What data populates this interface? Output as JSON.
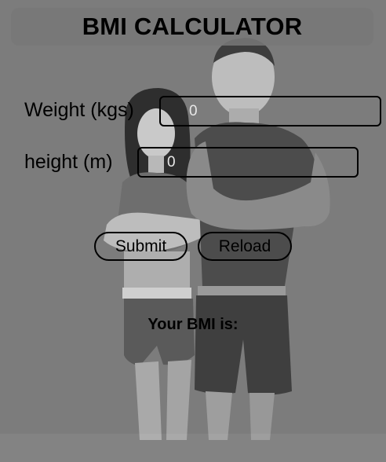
{
  "app": {
    "title": "BMI CALCULATOR"
  },
  "form": {
    "weight": {
      "label": "Weight (kgs)",
      "value": "0"
    },
    "height": {
      "label": "height (m)",
      "value": "0"
    }
  },
  "buttons": {
    "submit_label": "Submit",
    "reload_label": "Reload"
  },
  "result": {
    "label": "Your BMI is:"
  },
  "colors": {
    "background": "#7c7c7c",
    "text": "#000000",
    "input_text": "#e8e8e8"
  },
  "icons": {
    "background": "fitness-couple-photo"
  }
}
